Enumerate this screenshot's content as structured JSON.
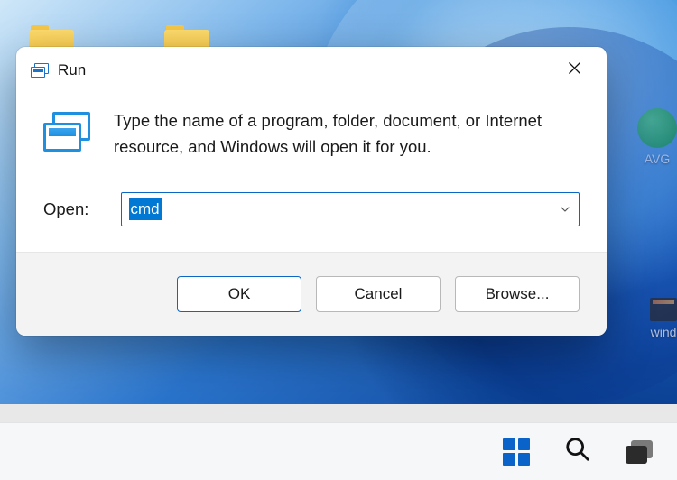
{
  "dialog": {
    "title": "Run",
    "description": "Type the name of a program, folder, document, or Internet resource, and Windows will open it for you.",
    "open_label": "Open:",
    "input_value": "cmd",
    "buttons": {
      "ok": "OK",
      "cancel": "Cancel",
      "browse": "Browse..."
    }
  },
  "desktop": {
    "right_labels": {
      "avg": "AVG",
      "wind": "wind"
    }
  },
  "colors": {
    "accent": "#0a68c4",
    "selection": "#0078d4"
  }
}
